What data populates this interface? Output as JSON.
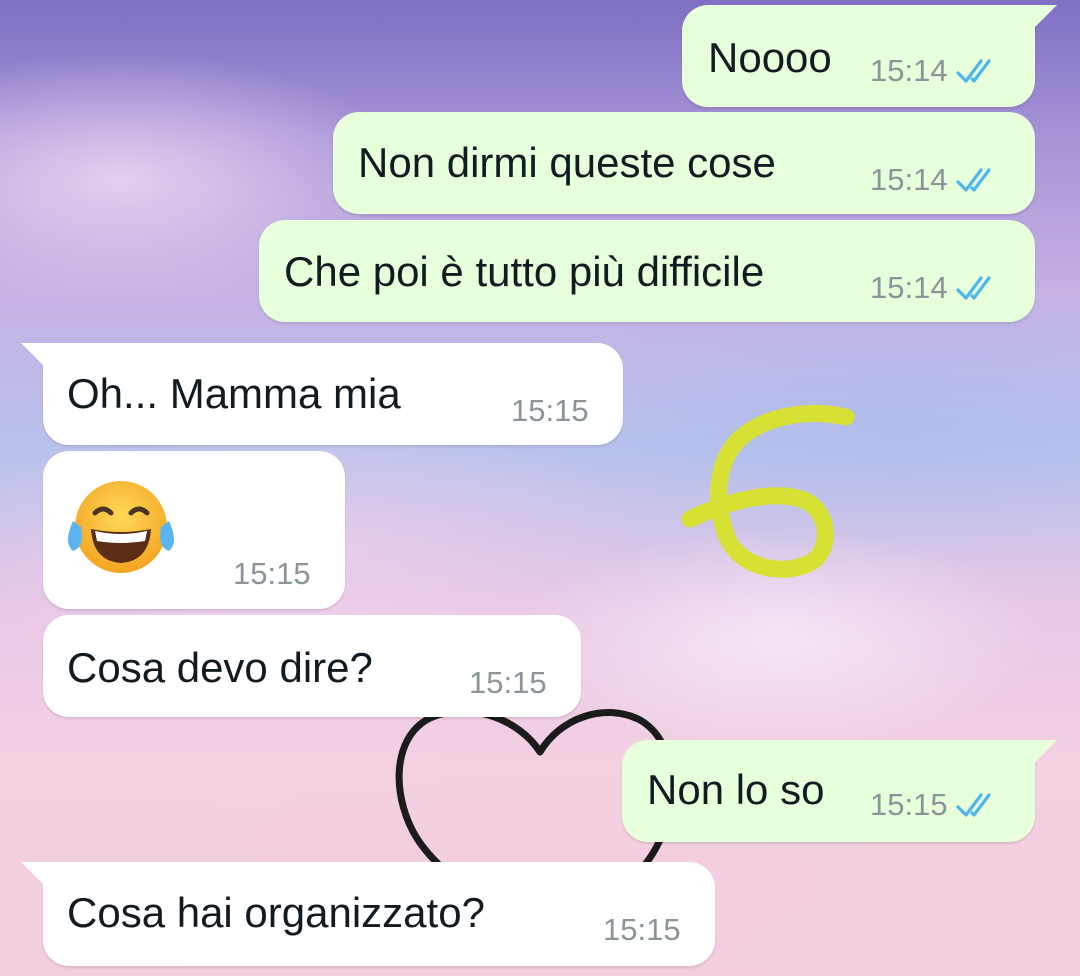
{
  "theme": {
    "outgoing_bubble": "#e7ffdb",
    "incoming_bubble": "#ffffff",
    "read_tick_color": "#4fb6ec",
    "doodle_six_color": "#d7e133",
    "doodle_heart_color": "#1b1b1b"
  },
  "conversation": {
    "messages": [
      {
        "direction": "outgoing",
        "text": "Noooo",
        "time": "15:14",
        "status": "read",
        "status_icon": "double-check-icon"
      },
      {
        "direction": "outgoing",
        "text": "Non dirmi queste cose",
        "time": "15:14",
        "status": "read",
        "status_icon": "double-check-icon"
      },
      {
        "direction": "outgoing",
        "text": "Che poi è tutto più difficile",
        "time": "15:14",
        "status": "read",
        "status_icon": "double-check-icon"
      },
      {
        "direction": "incoming",
        "text": "Oh... Mamma mia",
        "time": "15:15"
      },
      {
        "direction": "incoming",
        "text": "",
        "emoji": "face-with-tears-of-joy-icon",
        "time": "15:15"
      },
      {
        "direction": "incoming",
        "text": "Cosa devo dire?",
        "time": "15:15"
      },
      {
        "direction": "outgoing",
        "text": "Non lo so",
        "time": "15:15",
        "status": "read",
        "status_icon": "double-check-icon"
      },
      {
        "direction": "incoming",
        "text": "Cosa hai organizzato?",
        "time": "15:15"
      }
    ]
  },
  "annotations": {
    "handwritten_digit": "6",
    "doodle": "heart-icon"
  }
}
